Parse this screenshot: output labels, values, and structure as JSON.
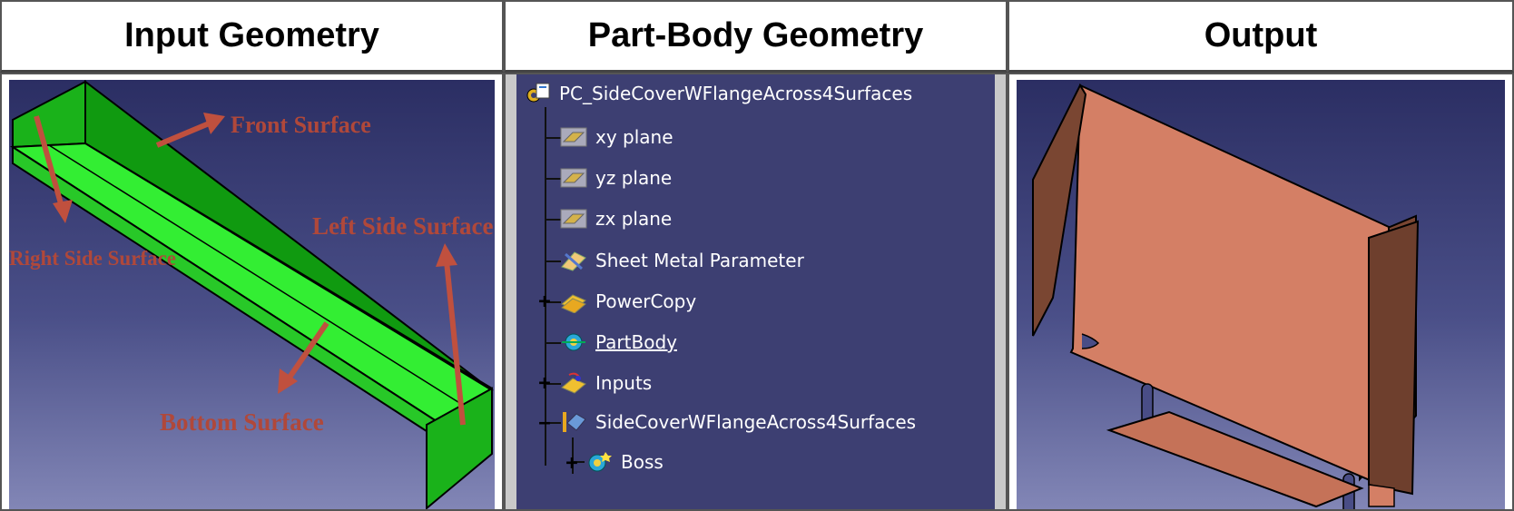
{
  "headers": [
    "Input Geometry",
    "Part-Body Geometry",
    "Output"
  ],
  "input_labels": {
    "front": "Front Surface",
    "left": "Left Side Surface",
    "right": "Right Side Surface",
    "bottom": "Bottom Surface"
  },
  "tree": {
    "root": "PC_SideCoverWFlangeAcross4Surfaces",
    "items": [
      {
        "label": "xy plane",
        "icon": "plane-icon"
      },
      {
        "label": "yz plane",
        "icon": "plane-icon"
      },
      {
        "label": "zx plane",
        "icon": "plane-icon"
      },
      {
        "label": "Sheet Metal Parameter",
        "icon": "sheet-metal-icon"
      },
      {
        "label": "PowerCopy",
        "icon": "powercopy-icon"
      },
      {
        "label": "PartBody",
        "icon": "partbody-icon"
      },
      {
        "label": "Inputs",
        "icon": "inputs-icon"
      },
      {
        "label": "SideCoverWFlangeAcross4Surfaces",
        "icon": "feature-icon"
      },
      {
        "label": "Boss",
        "icon": "boss-icon"
      }
    ]
  },
  "colors": {
    "input_part": "#22dd22",
    "output_part": "#d47f65",
    "label_red": "#b0483a",
    "background_top": "#2b2e63"
  }
}
